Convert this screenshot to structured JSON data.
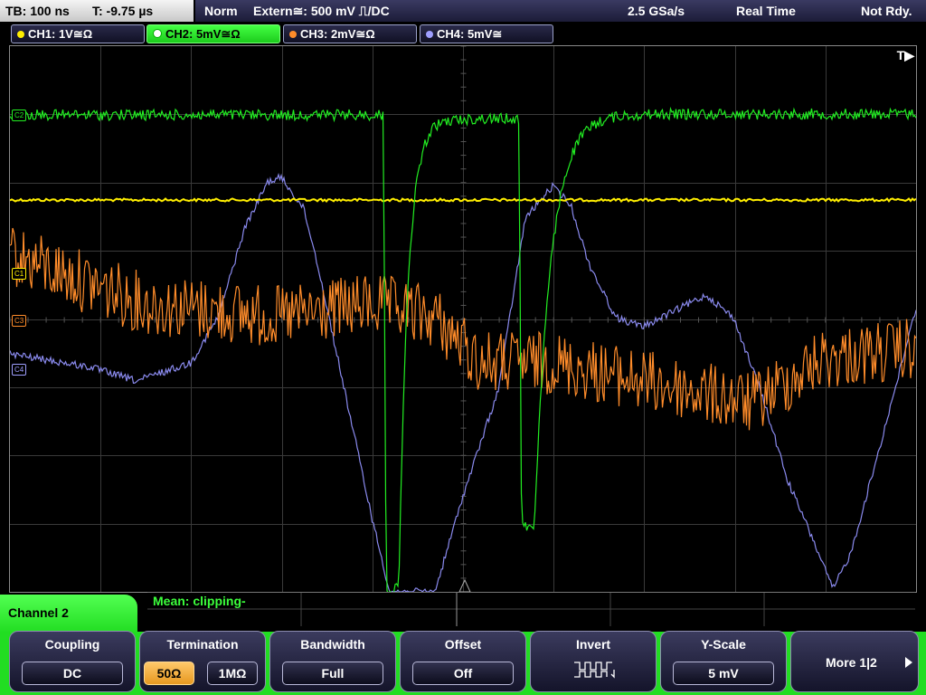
{
  "status": {
    "timebase": "TB: 100 ns",
    "trigger_time": "T: -9.75 µs",
    "mode": "Norm",
    "trigger_source": "Extern≅: 500 mV ⎍/DC",
    "sample_rate": "2.5 GSa/s",
    "acq_mode": "Real Time",
    "ready": "Not Rdy."
  },
  "channels": [
    {
      "label": "CH1: 1V≅Ω",
      "color": "#ffee00",
      "active": false
    },
    {
      "label": "CH2: 5mV≅Ω",
      "color": "#22ee22",
      "active": true
    },
    {
      "label": "CH3: 2mV≅Ω",
      "color": "#ff8c2a",
      "active": false
    },
    {
      "label": "CH4: 5mV≅",
      "color": "#9f9fff",
      "active": false
    }
  ],
  "markers": {
    "c1": "C1",
    "c2": "C2",
    "c3": "C3",
    "c4": "C4"
  },
  "trigger_indicator": "T▶",
  "measurement": {
    "label": "Mean: clipping-"
  },
  "panel": {
    "title": "Channel 2"
  },
  "softkeys": {
    "coupling": {
      "title": "Coupling",
      "value": "DC"
    },
    "termination": {
      "title": "Termination",
      "opt1": "50Ω",
      "opt2": "1MΩ",
      "selected": "50Ω"
    },
    "bandwidth": {
      "title": "Bandwidth",
      "value": "Full"
    },
    "offset": {
      "title": "Offset",
      "value": "Off"
    },
    "invert": {
      "title": "Invert"
    },
    "yscale": {
      "title": "Y-Scale",
      "value": "5 mV"
    },
    "more": {
      "label": "More 1|2"
    }
  },
  "colors": {
    "ch1": "#ffee00",
    "ch2": "#22ee22",
    "ch3": "#ff8c2a",
    "ch4": "#9f9fff",
    "grid": "#3a3a3a",
    "accent": "#22dd22"
  }
}
